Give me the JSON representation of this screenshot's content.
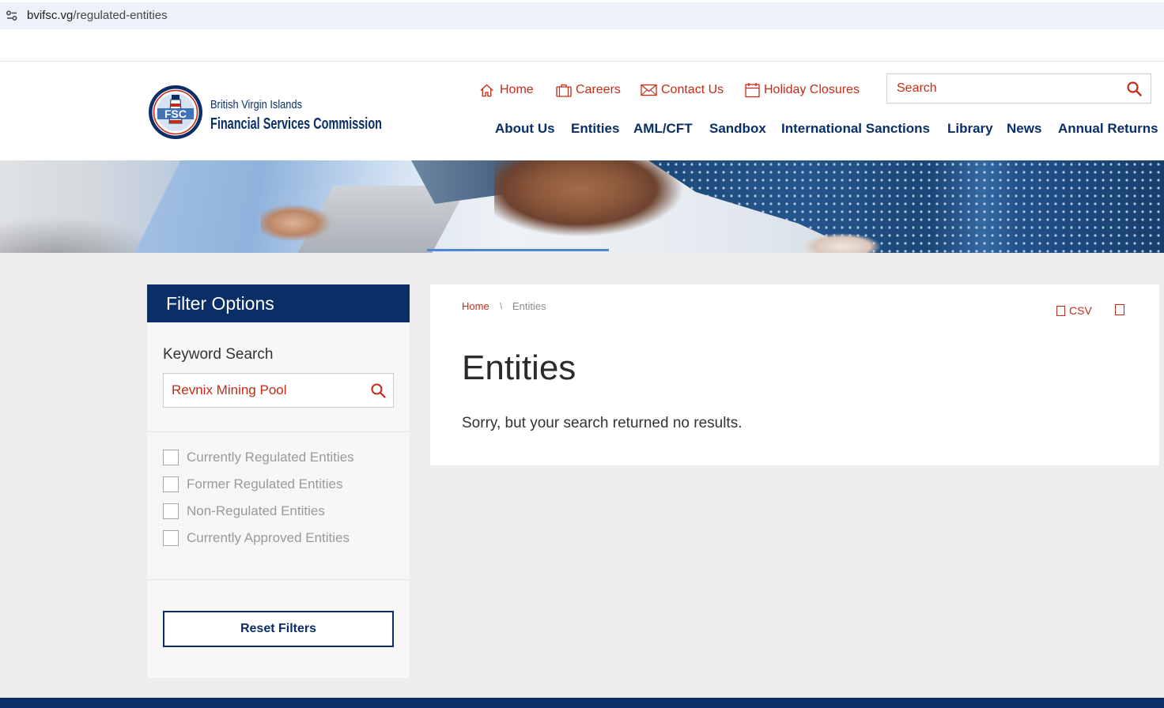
{
  "browser": {
    "url_domain": "bvifsc.vg",
    "url_path": "/regulated-entities",
    "site_info_icon": "tune-icon"
  },
  "header": {
    "logo": {
      "seal_text": "FSC",
      "line1": "British Virgin Islands",
      "line2": "Financial Services Commission"
    },
    "utility_links": [
      {
        "label": "Home",
        "icon": "home-icon"
      },
      {
        "label": "Careers",
        "icon": "briefcase-icon"
      },
      {
        "label": "Contact Us",
        "icon": "envelope-icon"
      },
      {
        "label": "Holiday Closures",
        "icon": "calendar-icon"
      }
    ],
    "search": {
      "placeholder": "Search",
      "icon": "search-icon"
    },
    "nav": [
      {
        "label": "About Us"
      },
      {
        "label": "Entities"
      },
      {
        "label": "AML/CFT"
      },
      {
        "label": "Sandbox"
      },
      {
        "label": "International Sanctions"
      },
      {
        "label": "Library"
      },
      {
        "label": "News"
      },
      {
        "label": "Annual Returns"
      }
    ]
  },
  "filters": {
    "title": "Filter Options",
    "keyword_label": "Keyword Search",
    "keyword_value": "Revnix Mining Pool",
    "keyword_icon": "search-icon",
    "options": [
      {
        "label": "Currently Regulated Entities",
        "checked": false
      },
      {
        "label": "Former Regulated Entities",
        "checked": false
      },
      {
        "label": "Non-Regulated Entities",
        "checked": false
      },
      {
        "label": "Currently Approved Entities",
        "checked": false
      }
    ],
    "reset_label": "Reset Filters"
  },
  "content": {
    "breadcrumb": [
      {
        "label": "Home"
      },
      {
        "label": "Entities"
      }
    ],
    "breadcrumb_separator": "\\",
    "export": {
      "csv_label": "CSV",
      "csv_icon": "file-icon",
      "print_icon": "print-icon"
    },
    "title": "Entities",
    "message": "Sorry, but your search returned no results."
  },
  "colors": {
    "brand_navy": "#0a2f66",
    "accent_red": "#c62b17",
    "page_bg": "#ededed"
  }
}
